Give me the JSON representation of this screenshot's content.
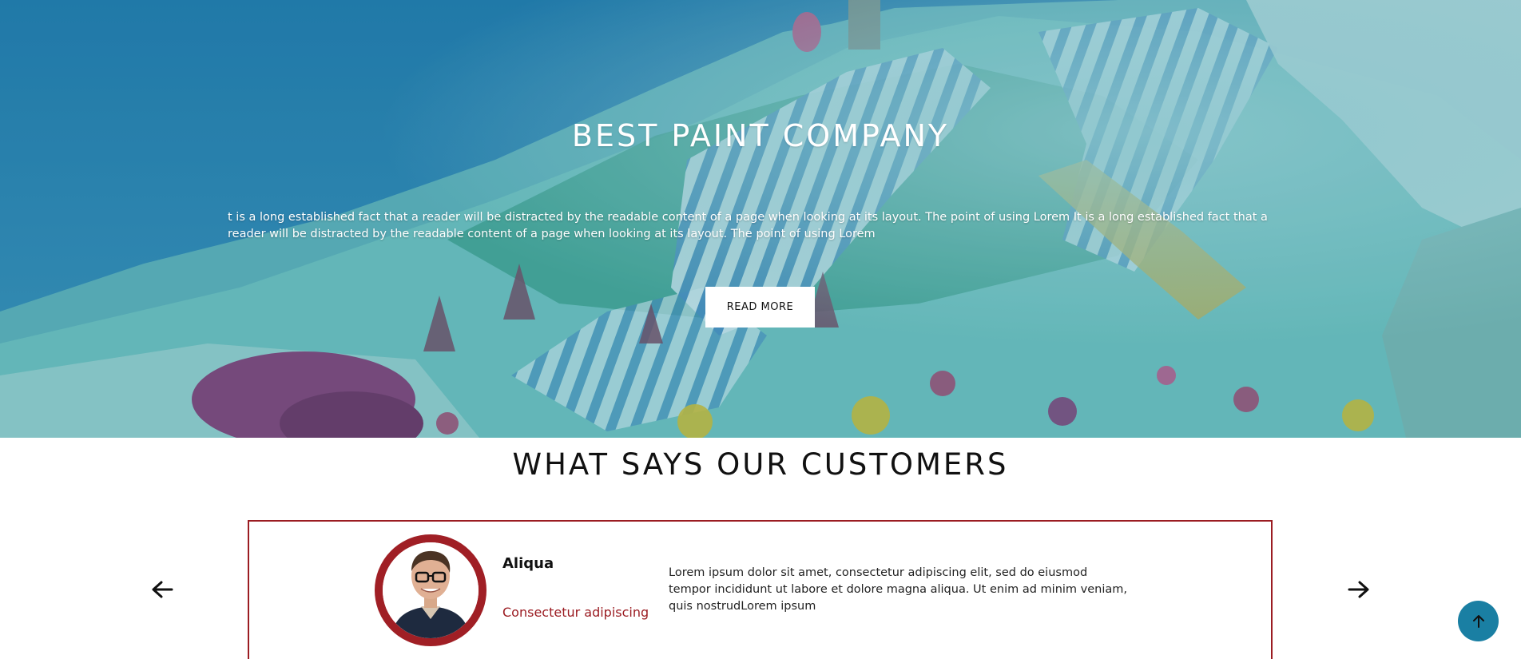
{
  "hero": {
    "title": "BEST PAINT COMPANY",
    "text": "t is a long established fact that a reader will be distracted by the readable content of a page when looking at its layout. The point of using Lorem It is a long established fact that a reader will be distracted by the readable content of a page when looking at its layout. The point of using Lorem",
    "button_label": "READ MORE",
    "image": "painted-mountain-photo"
  },
  "testimonials": {
    "heading": "WHAT SAYS OUR CUSTOMERS",
    "name": "Aliqua",
    "role": "Consectetur adipiscing",
    "quote": "Lorem ipsum dolor sit amet, consectetur adipiscing elit, sed do eiusmod tempor incididunt ut labore et dolore magna aliqua. Ut enim ad minim veniam, quis nostrudLorem ipsum",
    "prev_icon": "arrow-left-icon",
    "next_icon": "arrow-right-icon"
  },
  "back_to_top_icon": "arrow-up-icon",
  "colors": {
    "accent": "#9b1c22",
    "hero_overlay": "#1678a0",
    "back_to_top": "#1a7fa3",
    "button_bg": "#ffffff"
  }
}
